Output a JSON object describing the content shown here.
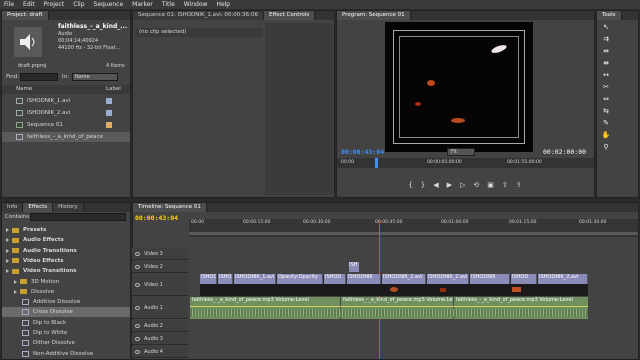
{
  "menu": [
    "File",
    "Edit",
    "Project",
    "Clip",
    "Sequence",
    "Marker",
    "Title",
    "Window",
    "Help"
  ],
  "project": {
    "tab": "Project: draft",
    "clip_name": "faithless_-_a_kind_...",
    "clip_type": "Audio",
    "clip_duration": "00;04;14;40924",
    "clip_format": "44100 Hz - 32-bit Float...",
    "project_file": "draft.prproj",
    "items_count": "4 Items",
    "find_label": "Find:",
    "in_label": "In:",
    "in_value": "Name",
    "col_name": "Name",
    "col_label": "Label",
    "items": [
      "ISHODNIK_1.avi",
      "ISHODNIK_2.avi",
      "Sequence 01",
      "faithless_-_a_kind_of_peace"
    ]
  },
  "source": {
    "tab": "Sequence 01: ISHODNIK_1.avi: 00:00:36:06",
    "effect_controls_tab": "Effect Controls",
    "no_clip": "(no clip selected)"
  },
  "program": {
    "tab": "Program: Sequence 01",
    "timecode": "00:00:43:04",
    "fit": "Fit",
    "duration": "00:02:00:00",
    "ruler": [
      "00:00",
      "00:00:05:00:00",
      "00:01:55:00:00"
    ]
  },
  "tools": {
    "tab": "Tools"
  },
  "effects": {
    "tabs": [
      "Info",
      "Effects",
      "History"
    ],
    "contains_label": "Contains:",
    "items": [
      {
        "label": "Presets",
        "level": 0,
        "kind": "folder"
      },
      {
        "label": "Audio Effects",
        "level": 0,
        "kind": "folder"
      },
      {
        "label": "Audio Transitions",
        "level": 0,
        "kind": "folder"
      },
      {
        "label": "Video Effects",
        "level": 0,
        "kind": "folder"
      },
      {
        "label": "Video Transitions",
        "level": 0,
        "kind": "folder"
      },
      {
        "label": "3D Motion",
        "level": 1,
        "kind": "folder"
      },
      {
        "label": "Dissolve",
        "level": 1,
        "kind": "folder"
      },
      {
        "label": "Additive Dissolve",
        "level": 2,
        "kind": "item"
      },
      {
        "label": "Cross Dissolve",
        "level": 2,
        "kind": "item"
      },
      {
        "label": "Dip to Black",
        "level": 2,
        "kind": "item"
      },
      {
        "label": "Dip to White",
        "level": 2,
        "kind": "item"
      },
      {
        "label": "Dither Dissolve",
        "level": 2,
        "kind": "item"
      },
      {
        "label": "Non-Additive Dissolve",
        "level": 2,
        "kind": "item"
      }
    ],
    "selected_index": 8
  },
  "timeline": {
    "tab": "Timeline: Sequence 01",
    "timecode": "00:00:43:04",
    "ruler": [
      "00:00",
      "00:00:15:00",
      "00:00:30:00",
      "00:00:45:00",
      "00:01:00:00",
      "00:01:15:00",
      "00:01:30:00"
    ],
    "video_tracks": [
      "Video 3",
      "Video 2",
      "Video 1"
    ],
    "audio_tracks": [
      "Audio 1",
      "Audio 2",
      "Audio 3",
      "Audio 4"
    ],
    "v1_clips": [
      "ISHOD",
      "ISHO",
      "ISHODNIK_1.avi",
      "Opacity:Opacity",
      "ISHOD",
      "ISHODNIK",
      "ISHODNIK_2.avi",
      "ISHODNIK_2.avi",
      "ISHODNIK",
      "ISHOD",
      "ISHODNIK_2.avi"
    ],
    "v2_clip": "ISH",
    "a1_clips": [
      "faithless_-_a_kind_of_peace.mp3 Volume:Level",
      "faithless_-_a_kind_of_peace.mp3 Volume:Level",
      "faithless_-_a_kind_of_peace.mp3 Volume:Level"
    ]
  },
  "colors": {
    "accent_time": "#3f8fff",
    "playhead": "#e05020",
    "video_clip": "#8b8bb8",
    "audio_clip": "#6f8f5f",
    "timecode_yellow": "#ffd200"
  }
}
